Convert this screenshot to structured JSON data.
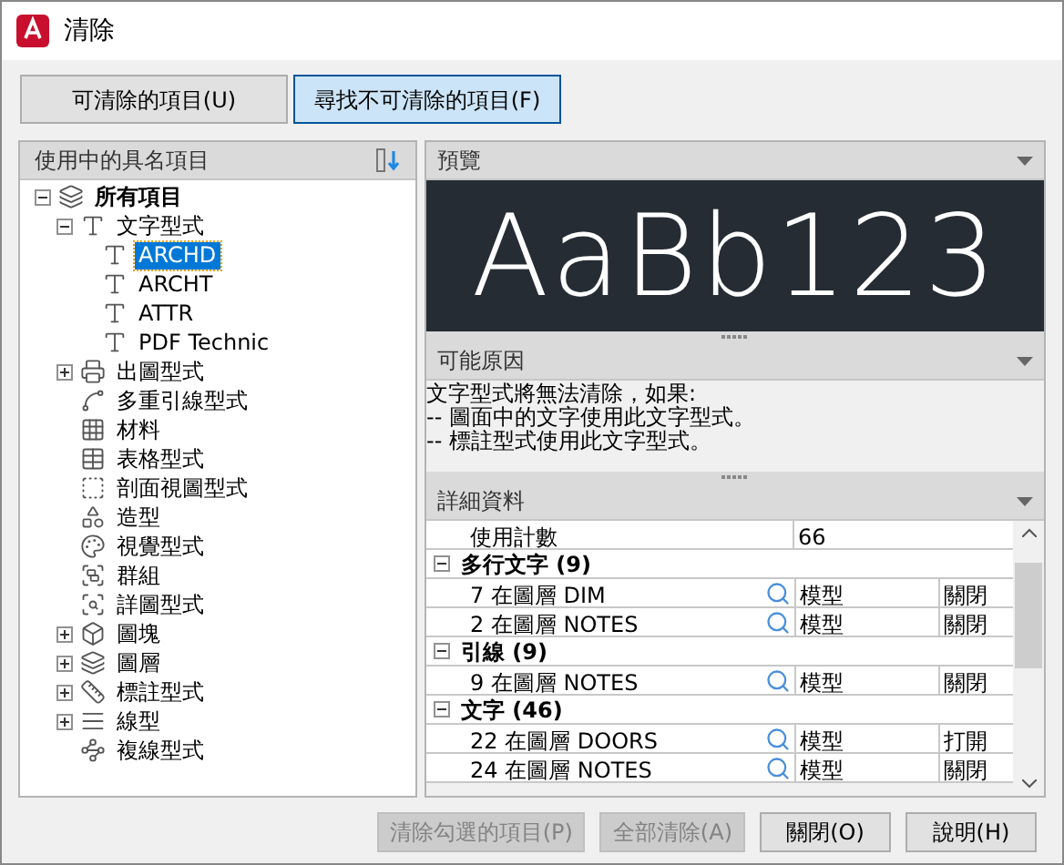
{
  "window": {
    "title": "清除"
  },
  "tabs": [
    {
      "label": "可清除的項目(U)",
      "selected": false
    },
    {
      "label": "尋找不可清除的項目(F)",
      "selected": true
    }
  ],
  "tree": {
    "header": "使用中的具名項目",
    "items": [
      {
        "label": "所有項目",
        "expanded": true,
        "selected": false,
        "children": [
          {
            "label": "文字型式",
            "expanded": true,
            "selected": false,
            "children": [
              {
                "label": "ARCHD",
                "selected": true
              },
              {
                "label": "ARCHT",
                "selected": false
              },
              {
                "label": "ATTR",
                "selected": false
              },
              {
                "label": "PDF Technic",
                "selected": false
              }
            ]
          },
          {
            "label": "出圖型式",
            "expanded": false,
            "selected": false
          },
          {
            "label": "多重引線型式",
            "selected": false
          },
          {
            "label": "材料",
            "selected": false
          },
          {
            "label": "表格型式",
            "selected": false
          },
          {
            "label": "剖面視圖型式",
            "selected": false
          },
          {
            "label": "造型",
            "selected": false
          },
          {
            "label": "視覺型式",
            "selected": false
          },
          {
            "label": "群組",
            "selected": false
          },
          {
            "label": "詳圖型式",
            "selected": false
          },
          {
            "label": "圖塊",
            "expanded": false,
            "selected": false
          },
          {
            "label": "圖層",
            "expanded": false,
            "selected": false
          },
          {
            "label": "標註型式",
            "expanded": false,
            "selected": false
          },
          {
            "label": "線型",
            "expanded": false,
            "selected": false
          },
          {
            "label": "複線型式",
            "selected": false
          }
        ]
      }
    ]
  },
  "preview": {
    "header": "預覽",
    "sample": "AaBb123"
  },
  "reasons": {
    "header": "可能原因",
    "lines": [
      "文字型式將無法清除，如果:",
      "-- 圖面中的文字使用此文字型式。",
      "-- 標註型式使用此文字型式。"
    ]
  },
  "details": {
    "header": "詳細資料",
    "rows": [
      {
        "kind": "property",
        "name": "使用計數",
        "value": "66"
      },
      {
        "kind": "group",
        "label": "多行文字 (9)",
        "expanded": true
      },
      {
        "kind": "entry",
        "name": "7 在圖層 DIM",
        "space": "模型",
        "state": "關閉"
      },
      {
        "kind": "entry",
        "name": "2 在圖層 NOTES",
        "space": "模型",
        "state": "關閉"
      },
      {
        "kind": "group",
        "label": "引線 (9)",
        "expanded": true
      },
      {
        "kind": "entry",
        "name": "9 在圖層 NOTES",
        "space": "模型",
        "state": "關閉"
      },
      {
        "kind": "group",
        "label": "文字 (46)",
        "expanded": true
      },
      {
        "kind": "entry",
        "name": "22 在圖層 DOORS",
        "space": "模型",
        "state": "打開"
      },
      {
        "kind": "entry",
        "name": "24 在圖層 NOTES",
        "space": "模型",
        "state": "關閉"
      }
    ]
  },
  "buttons": [
    {
      "label": "清除勾選的項目(P)",
      "disabled": true
    },
    {
      "label": "全部清除(A)",
      "disabled": true
    },
    {
      "label": "關閉(O)",
      "disabled": false
    },
    {
      "label": "說明(H)",
      "disabled": false
    }
  ]
}
